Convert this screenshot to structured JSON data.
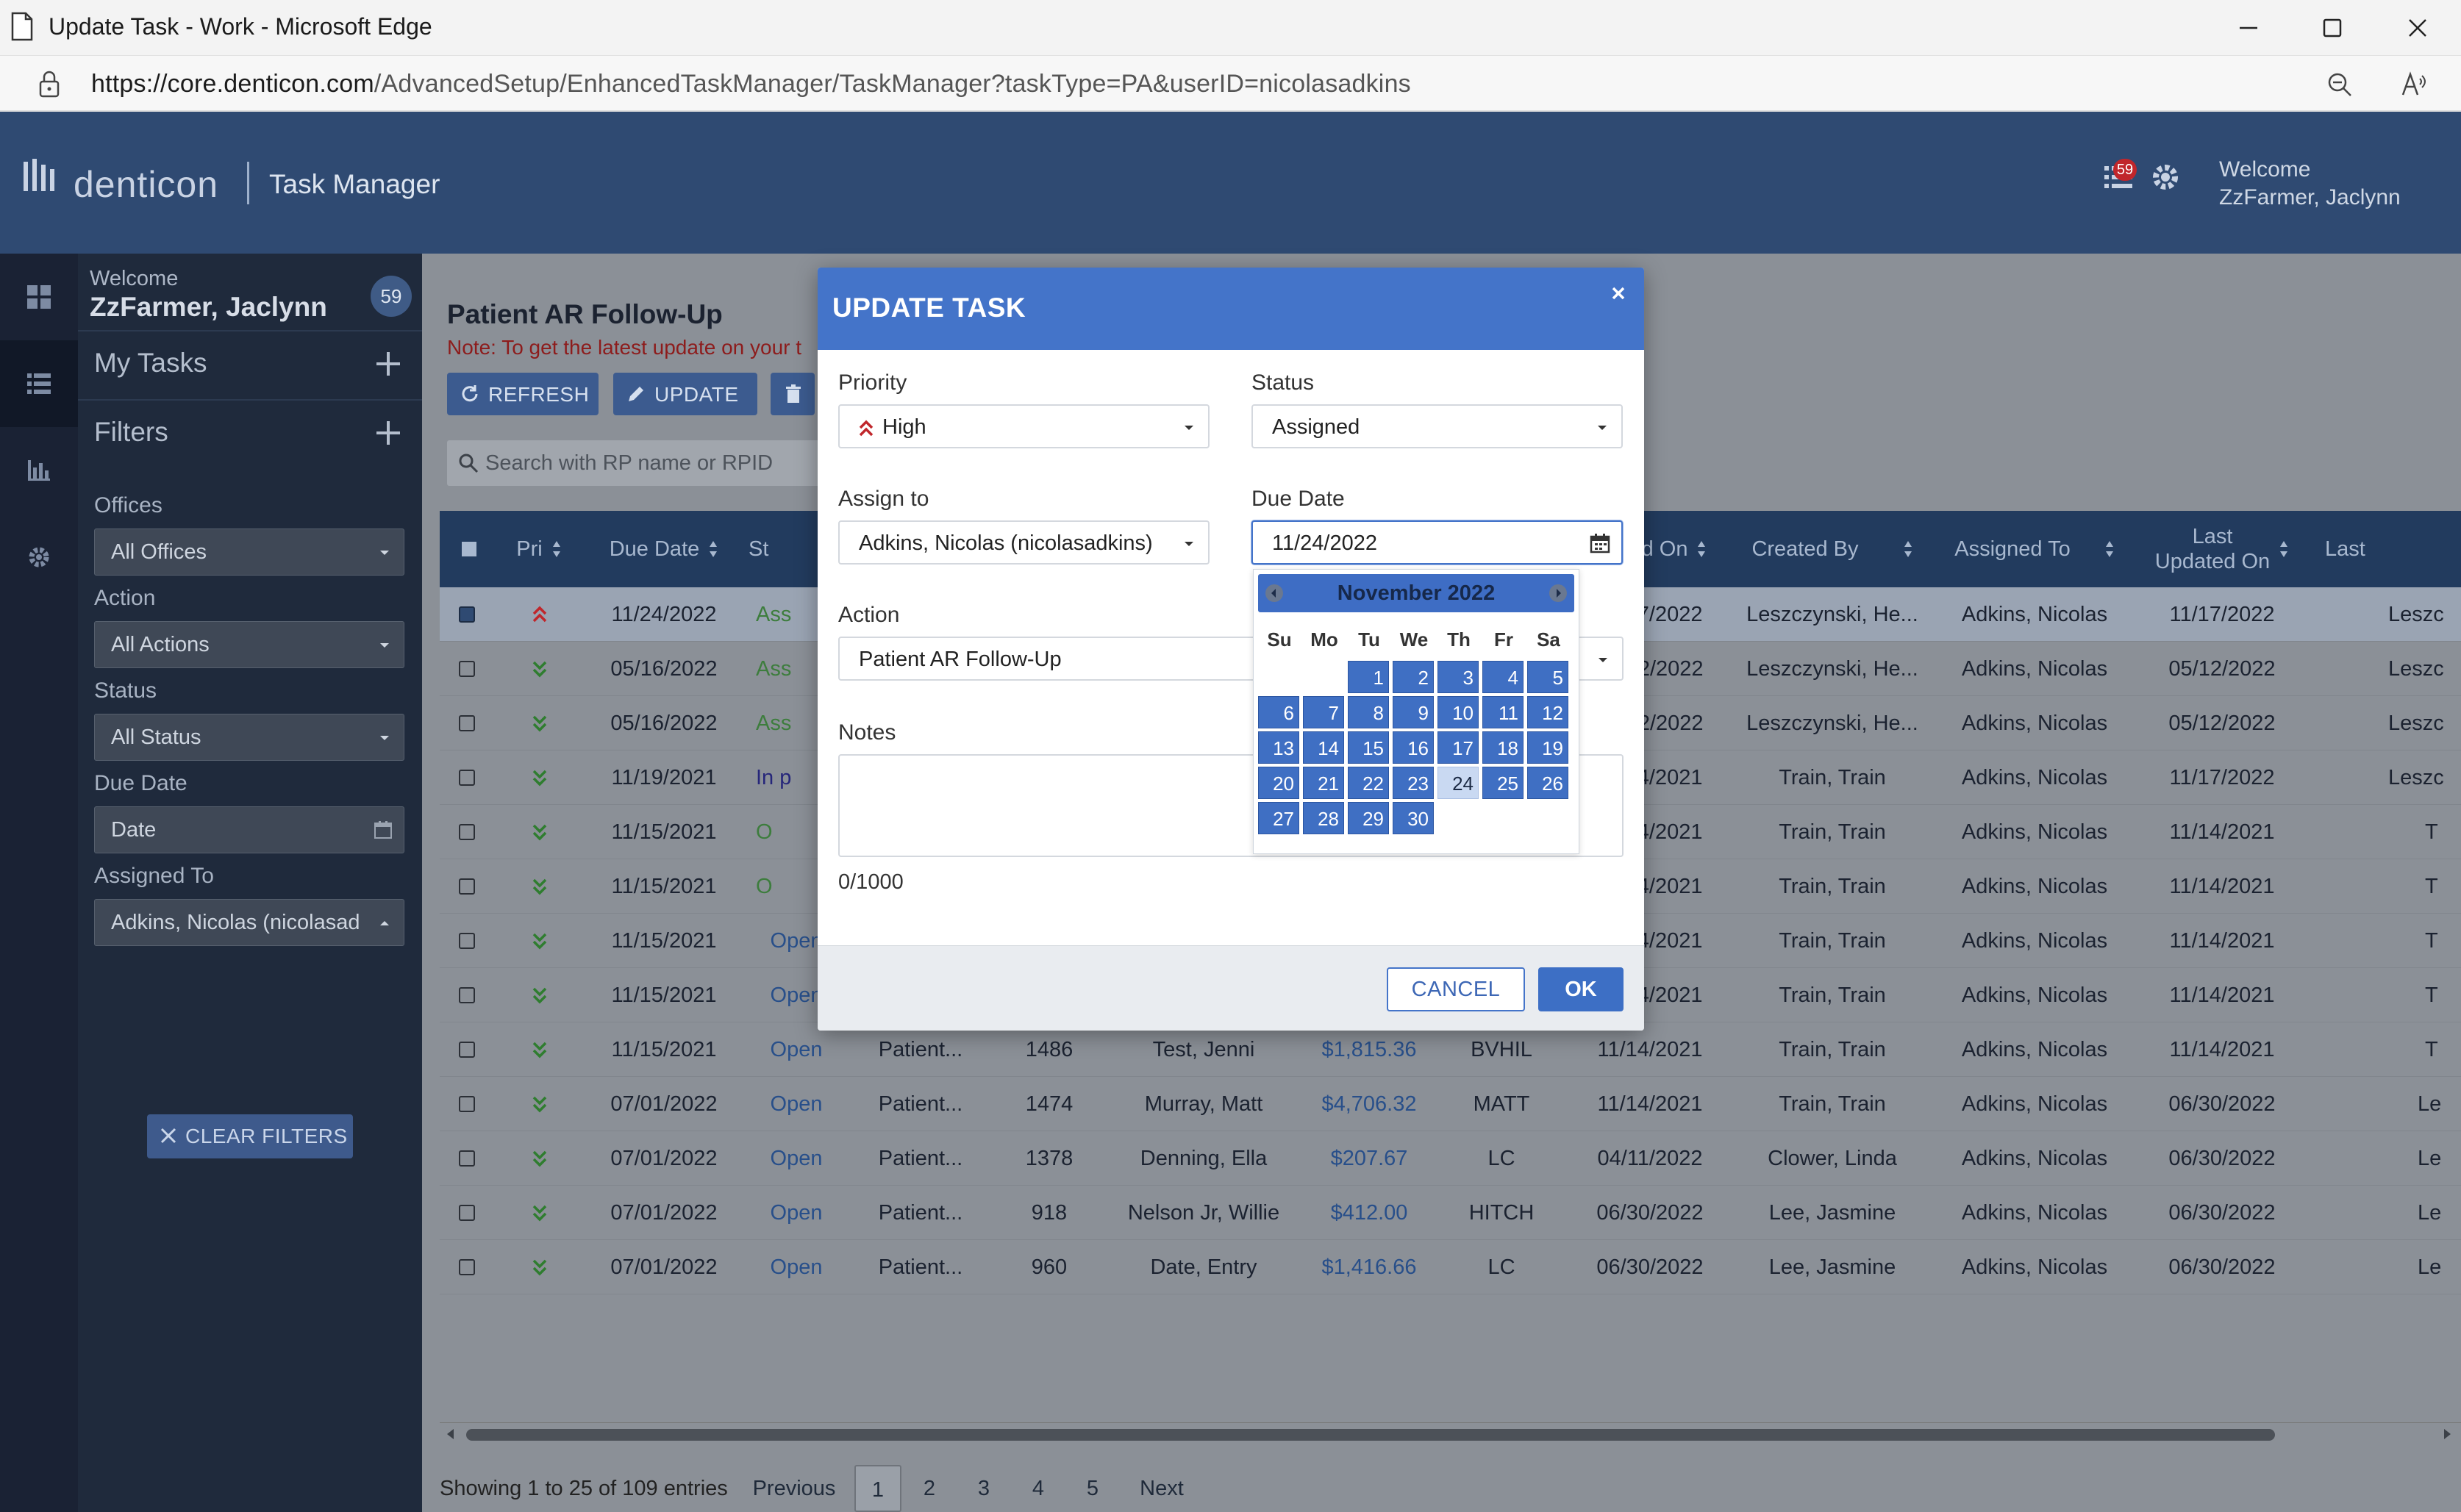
{
  "browser": {
    "window_title": "Update Task - Work - Microsoft Edge",
    "url_host": "https://core.denticon.com",
    "url_path": "/AdvancedSetup/EnhancedTaskManager/TaskManager?taskType=PA&userID=nicolasadkins"
  },
  "header": {
    "brand": "denticon",
    "app_title": "Task Manager",
    "notification_count": "59",
    "welcome_line1": "Welcome",
    "welcome_line2": "ZzFarmer, Jaclynn"
  },
  "sidebar": {
    "welcome_label": "Welcome",
    "user_name": "ZzFarmer, Jaclynn",
    "task_count": "59",
    "my_tasks": "My Tasks",
    "filters": "Filters",
    "offices_label": "Offices",
    "offices_value": "All Offices",
    "action_label": "Action",
    "action_value": "All Actions",
    "status_label": "Status",
    "status_value": "All Status",
    "due_date_label": "Due Date",
    "due_date_placeholder": "Date",
    "assigned_to_label": "Assigned To",
    "assigned_to_value": "Adkins, Nicolas (nicolasadk",
    "clear_filters": "CLEAR FILTERS"
  },
  "content": {
    "title": "Patient AR Follow-Up",
    "note": "Note: To get the latest update on your t",
    "refresh": "REFRESH",
    "update": "UPDATE",
    "search_placeholder": "Search with RP name or RPID"
  },
  "table": {
    "headers": {
      "pri": "Pri",
      "due_date": "Due Date",
      "status": "St",
      "created_on": "reated On",
      "created_by": "Created By",
      "assigned_to": "Assigned To",
      "last_updated_line1": "Last",
      "last_updated_line2": "Updated On",
      "last": "Last"
    },
    "rows": [
      {
        "due": "11/24/2022",
        "status": "Ass",
        "action": "",
        "rpid": "",
        "rp": "",
        "balance": "",
        "office": "",
        "created_on": "11/17/2022",
        "created_by": "Leszczynski, He...",
        "assigned_to": "Adkins, Nicolas",
        "last_updated": "11/17/2022",
        "last": "Leszc",
        "pri": "high"
      },
      {
        "due": "05/16/2022",
        "status": "Ass",
        "action": "",
        "rpid": "",
        "rp": "",
        "balance": "",
        "office": "",
        "created_on": "05/12/2022",
        "created_by": "Leszczynski, He...",
        "assigned_to": "Adkins, Nicolas",
        "last_updated": "05/12/2022",
        "last": "Leszc",
        "pri": "low"
      },
      {
        "due": "05/16/2022",
        "status": "Ass",
        "action": "",
        "rpid": "",
        "rp": "",
        "balance": "",
        "office": "",
        "created_on": "05/12/2022",
        "created_by": "Leszczynski, He...",
        "assigned_to": "Adkins, Nicolas",
        "last_updated": "05/12/2022",
        "last": "Leszc",
        "pri": "low"
      },
      {
        "due": "11/19/2021",
        "status": "In p",
        "action": "",
        "rpid": "",
        "rp": "",
        "balance": "",
        "office": "",
        "created_on": "11/14/2021",
        "created_by": "Train, Train",
        "assigned_to": "Adkins, Nicolas",
        "last_updated": "11/17/2022",
        "last": "Leszc",
        "pri": "low"
      },
      {
        "due": "11/15/2021",
        "status": "O",
        "action": "",
        "rpid": "",
        "rp": "",
        "balance": "",
        "office": "",
        "created_on": "11/14/2021",
        "created_by": "Train, Train",
        "assigned_to": "Adkins, Nicolas",
        "last_updated": "11/14/2021",
        "last": "T",
        "pri": "low"
      },
      {
        "due": "11/15/2021",
        "status": "O",
        "action": "",
        "rpid": "",
        "rp": "",
        "balance": "",
        "office": "",
        "created_on": "11/14/2021",
        "created_by": "Train, Train",
        "assigned_to": "Adkins, Nicolas",
        "last_updated": "11/14/2021",
        "last": "T",
        "pri": "low"
      },
      {
        "due": "11/15/2021",
        "status": "Open",
        "action": "Patient...",
        "rpid": "1279",
        "rp": "Testy, Patricia",
        "balance": "$1,024.29",
        "office": "BVHIL",
        "created_on": "11/14/2021",
        "created_by": "Train, Train",
        "assigned_to": "Adkins, Nicolas",
        "last_updated": "11/14/2021",
        "last": "T",
        "pri": "low"
      },
      {
        "due": "11/15/2021",
        "status": "Open",
        "action": "Patient...",
        "rpid": "1475",
        "rp": "Test, Sandra",
        "balance": "$3,009.33",
        "office": "BVHIL",
        "created_on": "11/14/2021",
        "created_by": "Train, Train",
        "assigned_to": "Adkins, Nicolas",
        "last_updated": "11/14/2021",
        "last": "T",
        "pri": "low"
      },
      {
        "due": "11/15/2021",
        "status": "Open",
        "action": "Patient...",
        "rpid": "1486",
        "rp": "Test, Jenni",
        "balance": "$1,815.36",
        "office": "BVHIL",
        "created_on": "11/14/2021",
        "created_by": "Train, Train",
        "assigned_to": "Adkins, Nicolas",
        "last_updated": "11/14/2021",
        "last": "T",
        "pri": "low"
      },
      {
        "due": "07/01/2022",
        "status": "Open",
        "action": "Patient...",
        "rpid": "1474",
        "rp": "Murray, Matt",
        "balance": "$4,706.32",
        "office": "MATT",
        "created_on": "11/14/2021",
        "created_by": "Train, Train",
        "assigned_to": "Adkins, Nicolas",
        "last_updated": "06/30/2022",
        "last": "Le",
        "pri": "low"
      },
      {
        "due": "07/01/2022",
        "status": "Open",
        "action": "Patient...",
        "rpid": "1378",
        "rp": "Denning, Ella",
        "balance": "$207.67",
        "office": "LC",
        "created_on": "04/11/2022",
        "created_by": "Clower, Linda",
        "assigned_to": "Adkins, Nicolas",
        "last_updated": "06/30/2022",
        "last": "Le",
        "pri": "low"
      },
      {
        "due": "07/01/2022",
        "status": "Open",
        "action": "Patient...",
        "rpid": "918",
        "rp": "Nelson Jr, Willie",
        "balance": "$412.00",
        "office": "HITCH",
        "created_on": "06/30/2022",
        "created_by": "Lee, Jasmine",
        "assigned_to": "Adkins, Nicolas",
        "last_updated": "06/30/2022",
        "last": "Le",
        "pri": "low"
      },
      {
        "due": "07/01/2022",
        "status": "Open",
        "action": "Patient...",
        "rpid": "960",
        "rp": "Date, Entry",
        "balance": "$1,416.66",
        "office": "LC",
        "created_on": "06/30/2022",
        "created_by": "Lee, Jasmine",
        "assigned_to": "Adkins, Nicolas",
        "last_updated": "06/30/2022",
        "last": "Le",
        "pri": "low"
      }
    ]
  },
  "pagination": {
    "info": "Showing 1 to 25 of 109 entries",
    "previous": "Previous",
    "pages": [
      "1",
      "2",
      "3",
      "4",
      "5"
    ],
    "current": "1",
    "next": "Next"
  },
  "modal": {
    "title": "UPDATE TASK",
    "priority_label": "Priority",
    "priority_value": "High",
    "status_label": "Status",
    "status_value": "Assigned",
    "assign_label": "Assign to",
    "assign_value": "Adkins, Nicolas (nicolasadkins)",
    "due_label": "Due Date",
    "due_value": "11/24/2022",
    "action_label": "Action",
    "action_value": "Patient AR Follow-Up",
    "notes_label": "Notes",
    "notes_value": "",
    "counter": "0/1000",
    "cancel": "CANCEL",
    "ok": "OK"
  },
  "datepicker": {
    "month_title": "November 2022",
    "weekdays": [
      "Su",
      "Mo",
      "Tu",
      "We",
      "Th",
      "Fr",
      "Sa"
    ],
    "first_weekday_index": 2,
    "days_in_month": 30,
    "hover_day": "24"
  },
  "colors": {
    "header_bg": "#2f4a72",
    "modal_accent": "#4474c9",
    "priority_high": "#c0262b",
    "priority_low": "#2f7d2f",
    "status_open": "#284f8a"
  }
}
